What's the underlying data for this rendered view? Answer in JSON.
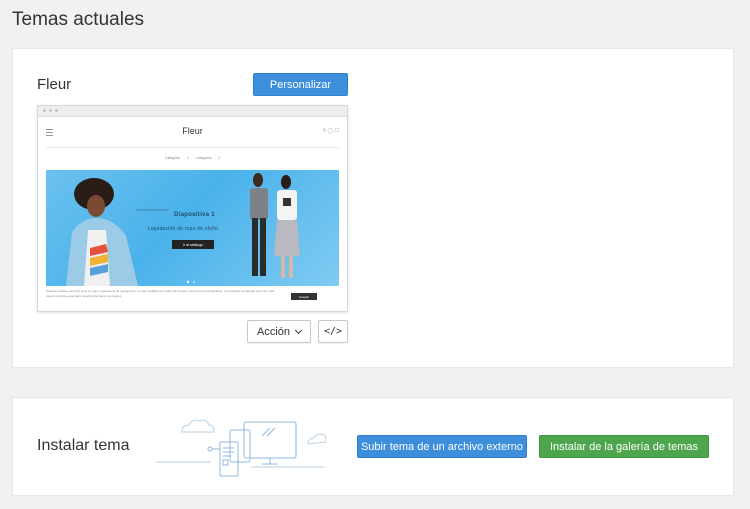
{
  "page": {
    "title": "Temas actuales"
  },
  "current_theme": {
    "name": "Fleur",
    "customize_label": "Personalizar",
    "action_label": "Acción",
    "code_label": "</>",
    "preview": {
      "logo": "Fleur",
      "nav_items": [
        "Categoría 1",
        "Categoría 2"
      ],
      "slide_title": "Diapositiva 1",
      "slide_subtitle": "Liquidación de ropa de otoño",
      "slide_button": "Ir al catálogo",
      "cookie_text": "Usamos cookies para ofrecerle la mejor experiencia de navegación, el mejor análisis del tráfico de la web y anuncios personalizados. Si continúas al navegar este sitio web, usted constituye aceptada nuestra Normativa de cookies",
      "cookie_button": "Aceptar"
    }
  },
  "install": {
    "title": "Instalar tema",
    "upload_label": "Subir tema de un archivo externo",
    "gallery_label": "Instalar de la galería de temas"
  },
  "colors": {
    "primary_blue": "#3d8fdc",
    "install_green": "#4da64d",
    "page_bg": "#f1f1f1"
  }
}
